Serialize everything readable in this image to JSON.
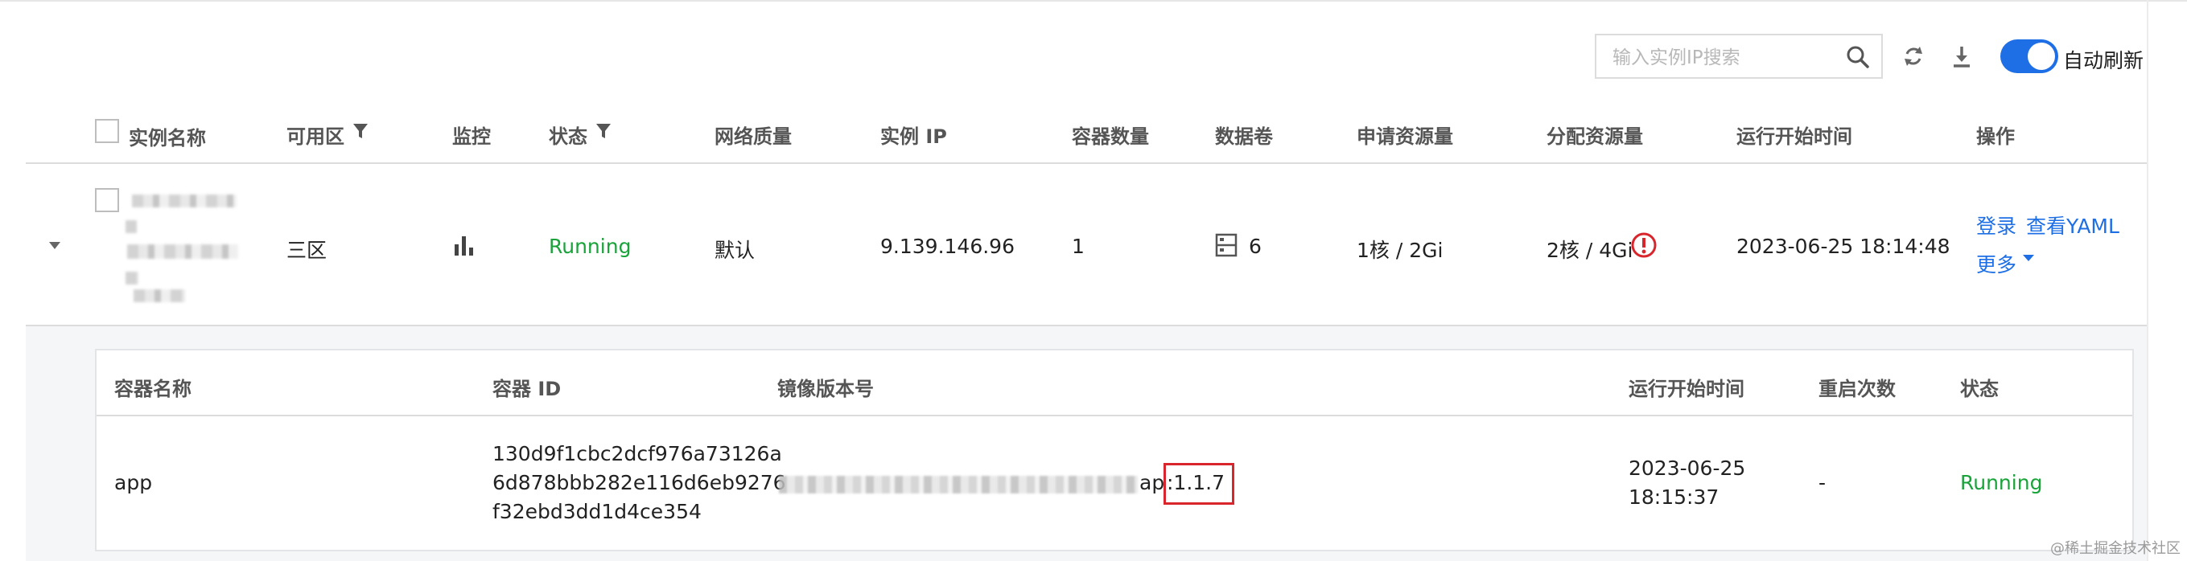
{
  "toolbar": {
    "search_placeholder": "输入实例IP搜索",
    "auto_refresh_label": "自动刷新",
    "auto_refresh_on": true
  },
  "table": {
    "headers": {
      "name": "实例名称",
      "zone": "可用区",
      "monitor": "监控",
      "status": "状态",
      "network": "网络质量",
      "ip": "实例 IP",
      "containers": "容器数量",
      "volumes": "数据卷",
      "requested": "申请资源量",
      "allocated": "分配资源量",
      "start_time": "运行开始时间",
      "actions": "操作"
    },
    "row": {
      "zone": "三区",
      "status": "Running",
      "network": "默认",
      "ip": "9.139.146.96",
      "containers": "1",
      "volumes": "6",
      "requested": "1核 / 2Gi",
      "allocated": "2核 / 4Gi",
      "start_time": "2023-06-25 18:14:48",
      "actions": {
        "login": "登录",
        "view_yaml": "查看YAML",
        "more": "更多"
      }
    }
  },
  "containers": {
    "headers": {
      "name": "容器名称",
      "id": "容器 ID",
      "image": "镜像版本号",
      "start_time": "运行开始时间",
      "restarts": "重启次数",
      "status": "状态"
    },
    "rows": [
      {
        "name": "app",
        "id_line1": "130d9f1cbc2dcf976a73126a",
        "id_line2": "6d878bbb282e116d6eb9276",
        "id_line3": "f32ebd3dd1d4ce354",
        "image_suffix": "ap",
        "image_tag": ":1.1.7",
        "start_date": "2023-06-25",
        "start_clock": "18:15:37",
        "restarts": "-",
        "status": "Running"
      }
    ]
  },
  "watermark": "@稀土掘金技术社区",
  "colors": {
    "accent": "#1e6fe6",
    "running": "#1aa33a",
    "warning": "#d8262c",
    "highlight_box": "#d8262c"
  }
}
